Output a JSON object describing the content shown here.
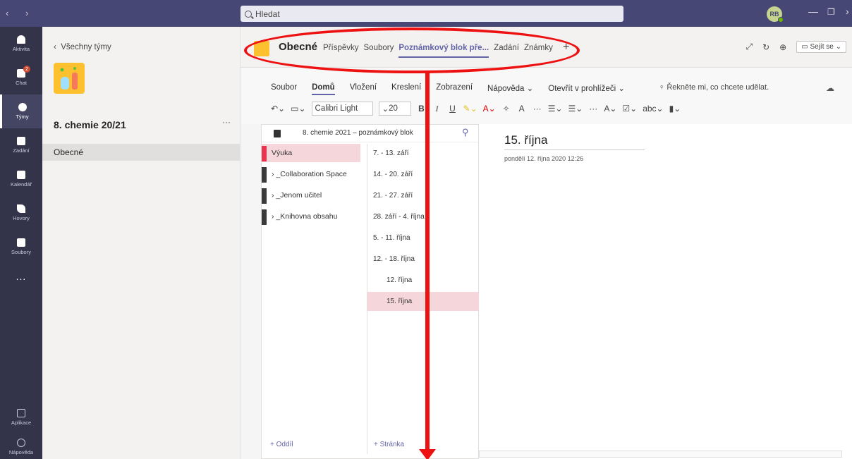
{
  "search": {
    "placeholder": "Hledat"
  },
  "user": {
    "initials": "RB"
  },
  "rail": [
    {
      "label": "Aktivita"
    },
    {
      "label": "Chat",
      "badge": "2"
    },
    {
      "label": "Týmy"
    },
    {
      "label": "Zadání"
    },
    {
      "label": "Kalendář"
    },
    {
      "label": "Hovory"
    },
    {
      "label": "Soubory"
    },
    {
      "label": "..."
    },
    {
      "label": "Aplikace"
    },
    {
      "label": "Nápověda"
    }
  ],
  "team_panel": {
    "back": "Všechny týmy",
    "team_name": "8. chemie 20/21",
    "more": "···",
    "channel": "Obecné"
  },
  "channel_header": {
    "name": "Obecné",
    "tabs": [
      "Příspěvky",
      "Soubory",
      "Poznámkový blok pře...",
      "Zadání",
      "Známky"
    ],
    "active_tab": "Poznámkový blok pře...",
    "plus": "+",
    "meet": "Sejít se"
  },
  "ribbon": {
    "menus": [
      "Soubor",
      "Domů",
      "Vložení",
      "Kreslení",
      "Zobrazení",
      "Nápověda"
    ],
    "active_menu": "Domů",
    "open_browser": "Otevřít v prohlížeči",
    "tell_me": "Řekněte mi, co chcete udělat.",
    "font": "Calibri Light",
    "size": "20"
  },
  "notebook": {
    "title": "8. chemie 2021 – poznámkový blok",
    "sections": [
      {
        "label": "Výuka",
        "color": "#e8344d"
      },
      {
        "label": "_Collaboration Space",
        "color": "#3a3a3a"
      },
      {
        "label": "_Jenom učitel",
        "color": "#3a3a3a"
      },
      {
        "label": "_Knihovna obsahu",
        "color": "#3a3a3a"
      }
    ],
    "pages": [
      {
        "label": "7. - 13. září"
      },
      {
        "label": "14. - 20. září"
      },
      {
        "label": "21. - 27. září"
      },
      {
        "label": "28. září - 4. října"
      },
      {
        "label": "5. - 11. října"
      },
      {
        "label": "12. - 18. října"
      },
      {
        "label": "12. října"
      },
      {
        "label": "15. října"
      }
    ],
    "add_section": "+ Oddíl",
    "add_page": "+ Stránka"
  },
  "page": {
    "title": "15. října",
    "date": "pondělí 12. října 2020   12:26"
  },
  "colors": {
    "accent": "#6264a7",
    "titlebar": "#464775",
    "rail": "#33344a",
    "annotation": "#ee1111"
  }
}
